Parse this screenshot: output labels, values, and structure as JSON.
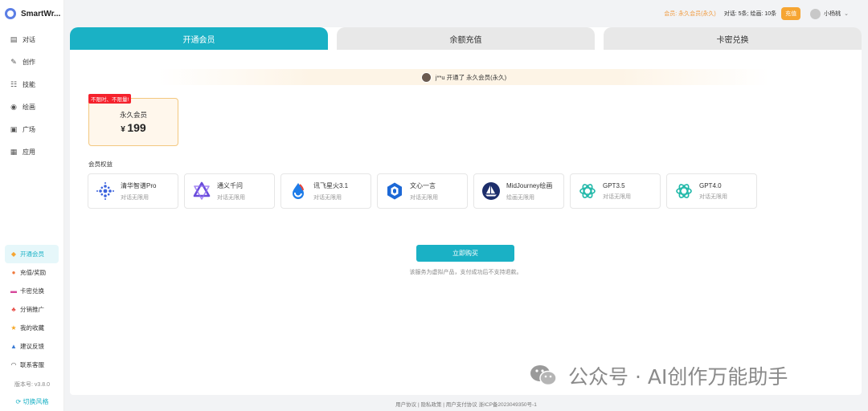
{
  "app": {
    "title": "SmartWr..."
  },
  "sidebar": {
    "nav": [
      {
        "icon": "chat-icon",
        "label": "对话"
      },
      {
        "icon": "pen-icon",
        "label": "创作"
      },
      {
        "icon": "skills-icon",
        "label": "技能"
      },
      {
        "icon": "palette-icon",
        "label": "绘画"
      },
      {
        "icon": "gallery-icon",
        "label": "广场"
      },
      {
        "icon": "apps-icon",
        "label": "应用"
      }
    ],
    "bottom": [
      {
        "icon": "vip-icon",
        "label": "开通会员",
        "active": true
      },
      {
        "icon": "recharge-icon",
        "label": "充值/奖励"
      },
      {
        "icon": "card-icon",
        "label": "卡密兑换"
      },
      {
        "icon": "share-icon",
        "label": "分销推广"
      },
      {
        "icon": "star-icon",
        "label": "我的收藏"
      },
      {
        "icon": "feedback-icon",
        "label": "建议反馈"
      },
      {
        "icon": "headset-icon",
        "label": "联系客服"
      }
    ],
    "version": "版本号: v3.8.0",
    "theme_switch": "切换风格"
  },
  "header": {
    "member": "会员: 永久会员(永久)",
    "usage": "对话: 5条; 绘画: 10条",
    "recharge": "充值",
    "username": "小杨桃"
  },
  "tabs": [
    "开通会员",
    "余额充值",
    "卡密兑换"
  ],
  "banner": {
    "text": "j**u 开通了 永久会员(永久)"
  },
  "plan": {
    "badge": "不限时、不限量!",
    "name": "永久会员",
    "currency": "¥",
    "price": "199"
  },
  "benefits_title": "会员权益",
  "benefits": [
    {
      "name": "清华智谱Pro",
      "desc": "对话无限用",
      "icon": "zhipu-icon",
      "color": "#3c63dd"
    },
    {
      "name": "通义千问",
      "desc": "对话无限用",
      "icon": "tongyi-icon",
      "color": "#6a4cdb"
    },
    {
      "name": "讯飞星火3.1",
      "desc": "对话无限用",
      "icon": "spark-icon",
      "color": "#1e7ce8"
    },
    {
      "name": "文心一言",
      "desc": "对话无限用",
      "icon": "wenxin-icon",
      "color": "#1c68d6"
    },
    {
      "name": "MidJourney绘画",
      "desc": "绘画无限用",
      "icon": "midjourney-icon",
      "color": "#1d2e6b"
    },
    {
      "name": "GPT3.5",
      "desc": "对话无限用",
      "icon": "openai-icon",
      "color": "#1fb8a8"
    },
    {
      "name": "GPT4.0",
      "desc": "对话无限用",
      "icon": "openai-icon",
      "color": "#1fb8a8"
    }
  ],
  "buy_button": "立即购买",
  "buy_note": "该服务为虚拟产品，支付成功后不支持退款。",
  "watermark": "公众号 · AI创作万能助手",
  "footer": "用户协议 | 隐私政策 | 用户支付协议   浙ICP备2023049350号-1",
  "colors": {
    "accent": "#1ab1c5",
    "orange": "#f6a532",
    "badge_red": "#f5222d"
  }
}
